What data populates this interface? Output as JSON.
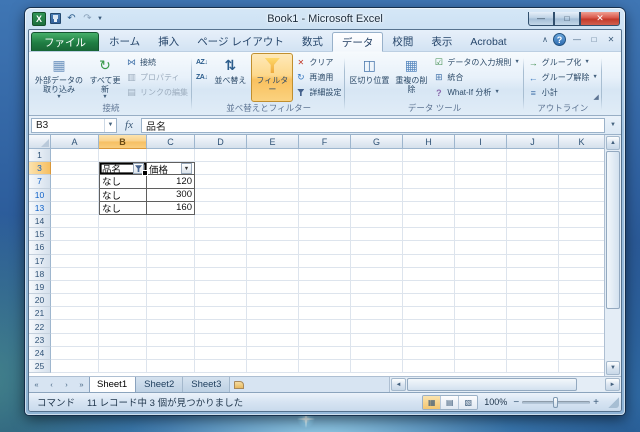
{
  "window": {
    "title": "Book1 - Microsoft Excel"
  },
  "glyphs": {
    "excel_logo": "X",
    "undo": "↶",
    "redo": "↷",
    "dropdown_small": "▼",
    "minimize": "—",
    "maximize": "□",
    "close": "✕",
    "collapse": "∧",
    "help": "?",
    "up": "▲",
    "down": "▼",
    "left": "◄",
    "right": "►",
    "nav_first": "«",
    "nav_prev": "‹",
    "nav_next": "›",
    "nav_last": "»",
    "launcher": "◢"
  },
  "icons": {
    "external_table": "▦",
    "refresh": "↻",
    "connection": "⋈",
    "properties": "▥",
    "edit_links": "▤",
    "sort_asc": "AZ↓",
    "sort_desc": "ZA↓",
    "sort_big": "⇅",
    "clear": "✕",
    "reapply": "↻",
    "advanced": "▼",
    "text_to_columns": "◫",
    "remove_duplicates": "▦",
    "validation": "☑",
    "consolidate": "⊞",
    "what_if": "?",
    "group": "→",
    "ungroup": "←",
    "subtotal": "≡",
    "views": [
      "▦",
      "▤",
      "▧"
    ]
  },
  "ribbon": {
    "active_tab": "データ",
    "tabs": [
      {
        "label": "ファイル"
      },
      {
        "label": "ホーム"
      },
      {
        "label": "挿入"
      },
      {
        "label": "ページ レイアウト"
      },
      {
        "label": "数式"
      },
      {
        "label": "データ"
      },
      {
        "label": "校閲"
      },
      {
        "label": "表示"
      },
      {
        "label": "Acrobat"
      }
    ],
    "groups": {
      "connections": {
        "label": "接続",
        "get_external": "外部データの取り込み",
        "refresh_all": "すべて更新",
        "connections": "接続",
        "properties": "プロパティ",
        "edit_links": "リンクの編集"
      },
      "sort_filter": {
        "label": "並べ替えとフィルター",
        "sort": "並べ替え",
        "filter": "フィルター",
        "clear": "クリア",
        "reapply": "再適用",
        "advanced": "詳細設定"
      },
      "data_tools": {
        "label": "データ ツール",
        "text_to_columns": "区切り位置",
        "remove_duplicates": "重複の削除",
        "validation": "データの入力規則",
        "consolidate": "統合",
        "what_if": "What-If 分析"
      },
      "outline": {
        "label": "アウトライン",
        "group": "グループ化",
        "ungroup": "グループ解除",
        "subtotal": "小計"
      }
    }
  },
  "formula_bar": {
    "name_box": "B3",
    "fx": "fx",
    "value": "品名"
  },
  "grid": {
    "columns": [
      "A",
      "B",
      "C",
      "D",
      "E",
      "F",
      "G",
      "H",
      "I",
      "J",
      "K"
    ],
    "selected_column": "B",
    "active_cell": "B3",
    "rows": [
      {
        "n": "1"
      },
      {
        "n": "3",
        "filtered": true,
        "selected": true,
        "cells": {
          "B": {
            "text": "品名",
            "icon": "filter",
            "active": true
          },
          "C": {
            "text": "価格",
            "icon": "dropdown"
          }
        }
      },
      {
        "n": "7",
        "filtered": true,
        "cells": {
          "B": {
            "text": "なし"
          },
          "C": {
            "text": "120",
            "align": "right"
          }
        }
      },
      {
        "n": "10",
        "filtered": true,
        "cells": {
          "B": {
            "text": "なし"
          },
          "C": {
            "text": "300",
            "align": "right"
          }
        }
      },
      {
        "n": "13",
        "filtered": true,
        "cells": {
          "B": {
            "text": "なし"
          },
          "C": {
            "text": "160",
            "align": "right"
          }
        }
      },
      {
        "n": "14"
      },
      {
        "n": "15"
      },
      {
        "n": "16"
      },
      {
        "n": "17"
      },
      {
        "n": "18"
      },
      {
        "n": "19"
      },
      {
        "n": "20"
      },
      {
        "n": "21"
      },
      {
        "n": "22"
      },
      {
        "n": "23"
      },
      {
        "n": "24"
      },
      {
        "n": "25"
      }
    ]
  },
  "sheet_tabs": {
    "tabs": [
      "Sheet1",
      "Sheet2",
      "Sheet3"
    ],
    "active": "Sheet1"
  },
  "status_bar": {
    "mode": "コマンド",
    "message": "11 レコード中 3 個が見つかりました",
    "zoom": "100%"
  }
}
